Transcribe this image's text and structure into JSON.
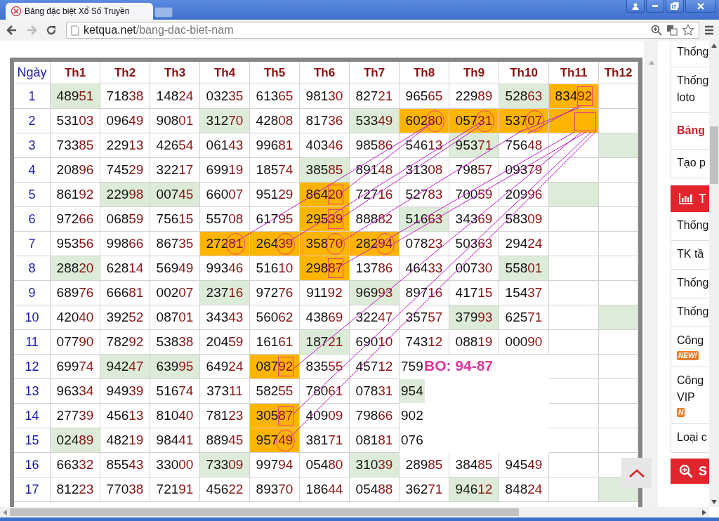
{
  "window": {
    "tab_title": "Bảng đặc biệt Xổ Số Truyền",
    "address": {
      "host": "ketqua.net",
      "path": "/bang-dac-biet-nam"
    }
  },
  "table": {
    "corner": "Ngày",
    "columns": [
      "Th1",
      "Th2",
      "Th3",
      "Th4",
      "Th5",
      "Th6",
      "Th7",
      "Th8",
      "Th9",
      "Th10",
      "Th11",
      "Th12"
    ],
    "rows": [
      {
        "day": "1",
        "cells": [
          {
            "kind": "number",
            "value": "48951",
            "color": "#dcecd8"
          },
          {
            "kind": "number",
            "value": "71838"
          },
          {
            "kind": "number",
            "value": "14824"
          },
          {
            "kind": "number",
            "value": "03235"
          },
          {
            "kind": "number",
            "value": "61365"
          },
          {
            "kind": "number",
            "value": "98130"
          },
          {
            "kind": "number",
            "value": "82721"
          },
          {
            "kind": "number",
            "value": "96565"
          },
          {
            "kind": "number",
            "value": "22989"
          },
          {
            "kind": "number",
            "value": "52863",
            "color": "#dcecd8"
          },
          {
            "kind": "number",
            "value": "83492",
            "color": "#ffb400"
          },
          {
            "kind": "empty"
          }
        ]
      },
      {
        "day": "2",
        "cells": [
          {
            "kind": "number",
            "value": "53103"
          },
          {
            "kind": "number",
            "value": "09649"
          },
          {
            "kind": "number",
            "value": "90801"
          },
          {
            "kind": "number",
            "value": "31270",
            "color": "#dcecd8"
          },
          {
            "kind": "number",
            "value": "42808"
          },
          {
            "kind": "number",
            "value": "81736"
          },
          {
            "kind": "number",
            "value": "53349",
            "color": "#dcecd8"
          },
          {
            "kind": "number",
            "value": "60280",
            "color": "#ffb400"
          },
          {
            "kind": "number",
            "value": "05731",
            "color": "#ffb400"
          },
          {
            "kind": "number",
            "value": "53707",
            "color": "#ffb400"
          },
          {
            "kind": "empty",
            "color": "#ffb400"
          },
          {
            "kind": "empty"
          }
        ]
      },
      {
        "day": "3",
        "cells": [
          {
            "kind": "number",
            "value": "73385"
          },
          {
            "kind": "number",
            "value": "22913"
          },
          {
            "kind": "number",
            "value": "42654"
          },
          {
            "kind": "number",
            "value": "06143"
          },
          {
            "kind": "number",
            "value": "99681"
          },
          {
            "kind": "number",
            "value": "40346"
          },
          {
            "kind": "number",
            "value": "98586"
          },
          {
            "kind": "number",
            "value": "54613"
          },
          {
            "kind": "number",
            "value": "95371",
            "color": "#dcecd8"
          },
          {
            "kind": "number",
            "value": "75648"
          },
          {
            "kind": "empty"
          },
          {
            "kind": "empty",
            "color": "#dcecd8"
          }
        ]
      },
      {
        "day": "4",
        "cells": [
          {
            "kind": "number",
            "value": "20896"
          },
          {
            "kind": "number",
            "value": "74529"
          },
          {
            "kind": "number",
            "value": "32217"
          },
          {
            "kind": "number",
            "value": "69919"
          },
          {
            "kind": "number",
            "value": "18574"
          },
          {
            "kind": "number",
            "value": "38585",
            "color": "#dcecd8"
          },
          {
            "kind": "number",
            "value": "89148"
          },
          {
            "kind": "number",
            "value": "31308"
          },
          {
            "kind": "number",
            "value": "79857"
          },
          {
            "kind": "number",
            "value": "09379"
          },
          {
            "kind": "empty"
          },
          {
            "kind": "empty"
          }
        ]
      },
      {
        "day": "5",
        "cells": [
          {
            "kind": "number",
            "value": "86192"
          },
          {
            "kind": "number",
            "value": "22998",
            "color": "#dcecd8"
          },
          {
            "kind": "number",
            "value": "00745",
            "color": "#dcecd8"
          },
          {
            "kind": "number",
            "value": "66007"
          },
          {
            "kind": "number",
            "value": "95129"
          },
          {
            "kind": "number",
            "value": "86420",
            "color": "#ffb400"
          },
          {
            "kind": "number",
            "value": "72716"
          },
          {
            "kind": "number",
            "value": "52783"
          },
          {
            "kind": "number",
            "value": "70059"
          },
          {
            "kind": "number",
            "value": "20996"
          },
          {
            "kind": "empty",
            "color": "#dcecd8"
          },
          {
            "kind": "empty"
          }
        ]
      },
      {
        "day": "6",
        "cells": [
          {
            "kind": "number",
            "value": "97266"
          },
          {
            "kind": "number",
            "value": "06859"
          },
          {
            "kind": "number",
            "value": "75615"
          },
          {
            "kind": "number",
            "value": "55708"
          },
          {
            "kind": "number",
            "value": "61795"
          },
          {
            "kind": "number",
            "value": "29539",
            "color": "#ffb400"
          },
          {
            "kind": "number",
            "value": "88882"
          },
          {
            "kind": "number",
            "value": "51663",
            "color": "#dcecd8"
          },
          {
            "kind": "number",
            "value": "34369"
          },
          {
            "kind": "number",
            "value": "58309"
          },
          {
            "kind": "empty"
          },
          {
            "kind": "empty"
          }
        ]
      },
      {
        "day": "7",
        "cells": [
          {
            "kind": "number",
            "value": "95356"
          },
          {
            "kind": "number",
            "value": "99866"
          },
          {
            "kind": "number",
            "value": "86735"
          },
          {
            "kind": "number",
            "value": "27281",
            "color": "#ffb400"
          },
          {
            "kind": "number",
            "value": "26439",
            "color": "#ffb400"
          },
          {
            "kind": "number",
            "value": "35870",
            "color": "#ffb400"
          },
          {
            "kind": "number",
            "value": "28294",
            "color": "#ffb400"
          },
          {
            "kind": "number",
            "value": "07823"
          },
          {
            "kind": "number",
            "value": "50363"
          },
          {
            "kind": "number",
            "value": "29424"
          },
          {
            "kind": "empty"
          },
          {
            "kind": "empty"
          }
        ]
      },
      {
        "day": "8",
        "cells": [
          {
            "kind": "number",
            "value": "28820",
            "color": "#dcecd8"
          },
          {
            "kind": "number",
            "value": "62814"
          },
          {
            "kind": "number",
            "value": "56949"
          },
          {
            "kind": "number",
            "value": "99346"
          },
          {
            "kind": "number",
            "value": "51610"
          },
          {
            "kind": "number",
            "value": "29887",
            "color": "#ffb400"
          },
          {
            "kind": "number",
            "value": "13786"
          },
          {
            "kind": "number",
            "value": "46433"
          },
          {
            "kind": "number",
            "value": "00730"
          },
          {
            "kind": "number",
            "value": "55801",
            "color": "#dcecd8"
          },
          {
            "kind": "empty"
          },
          {
            "kind": "empty"
          }
        ]
      },
      {
        "day": "9",
        "cells": [
          {
            "kind": "number",
            "value": "68976"
          },
          {
            "kind": "number",
            "value": "66681"
          },
          {
            "kind": "number",
            "value": "00207"
          },
          {
            "kind": "number",
            "value": "23716",
            "color": "#dcecd8"
          },
          {
            "kind": "number",
            "value": "97276"
          },
          {
            "kind": "number",
            "value": "91192"
          },
          {
            "kind": "number",
            "value": "96993",
            "color": "#dcecd8"
          },
          {
            "kind": "number",
            "value": "89716"
          },
          {
            "kind": "number",
            "value": "41715"
          },
          {
            "kind": "number",
            "value": "15437"
          },
          {
            "kind": "empty"
          },
          {
            "kind": "empty"
          }
        ]
      },
      {
        "day": "10",
        "cells": [
          {
            "kind": "number",
            "value": "42040"
          },
          {
            "kind": "number",
            "value": "39252"
          },
          {
            "kind": "number",
            "value": "08701"
          },
          {
            "kind": "number",
            "value": "34343"
          },
          {
            "kind": "number",
            "value": "56062"
          },
          {
            "kind": "number",
            "value": "43869"
          },
          {
            "kind": "number",
            "value": "32247"
          },
          {
            "kind": "number",
            "value": "35757"
          },
          {
            "kind": "number",
            "value": "37993",
            "color": "#dcecd8"
          },
          {
            "kind": "number",
            "value": "62571"
          },
          {
            "kind": "empty"
          },
          {
            "kind": "empty",
            "color": "#dcecd8"
          }
        ]
      },
      {
        "day": "11",
        "cells": [
          {
            "kind": "number",
            "value": "07790"
          },
          {
            "kind": "number",
            "value": "78292"
          },
          {
            "kind": "number",
            "value": "53838"
          },
          {
            "kind": "number",
            "value": "20459"
          },
          {
            "kind": "number",
            "value": "16161"
          },
          {
            "kind": "number",
            "value": "18721",
            "color": "#dcecd8"
          },
          {
            "kind": "number",
            "value": "69010"
          },
          {
            "kind": "number",
            "value": "74312"
          },
          {
            "kind": "number",
            "value": "08819"
          },
          {
            "kind": "number",
            "value": "00090"
          },
          {
            "kind": "empty"
          },
          {
            "kind": "empty"
          }
        ]
      },
      {
        "day": "12",
        "cells": [
          {
            "kind": "number",
            "value": "69974"
          },
          {
            "kind": "number",
            "value": "94247",
            "color": "#dcecd8"
          },
          {
            "kind": "number",
            "value": "63995",
            "color": "#dcecd8"
          },
          {
            "kind": "number",
            "value": "64924"
          },
          {
            "kind": "number",
            "value": "08792",
            "color": "#ffb400"
          },
          {
            "kind": "number",
            "value": "83555"
          },
          {
            "kind": "number",
            "value": "45712"
          },
          {
            "kind": "cut",
            "value": "759"
          },
          {
            "kind": "covered"
          },
          {
            "kind": "covered"
          },
          {
            "kind": "empty"
          },
          {
            "kind": "empty"
          }
        ]
      },
      {
        "day": "13",
        "cells": [
          {
            "kind": "number",
            "value": "96334"
          },
          {
            "kind": "number",
            "value": "94939"
          },
          {
            "kind": "number",
            "value": "51674"
          },
          {
            "kind": "number",
            "value": "37311"
          },
          {
            "kind": "number",
            "value": "58255"
          },
          {
            "kind": "number",
            "value": "78061"
          },
          {
            "kind": "number",
            "value": "07831"
          },
          {
            "kind": "cut",
            "value": "954",
            "color": "#dcecd8"
          },
          {
            "kind": "covered"
          },
          {
            "kind": "covered"
          },
          {
            "kind": "empty"
          },
          {
            "kind": "empty"
          }
        ]
      },
      {
        "day": "14",
        "cells": [
          {
            "kind": "number",
            "value": "27739"
          },
          {
            "kind": "number",
            "value": "45613"
          },
          {
            "kind": "number",
            "value": "81040"
          },
          {
            "kind": "number",
            "value": "78123"
          },
          {
            "kind": "number",
            "value": "30587",
            "color": "#ffb400"
          },
          {
            "kind": "number",
            "value": "40909"
          },
          {
            "kind": "number",
            "value": "79866"
          },
          {
            "kind": "cut",
            "value": "902"
          },
          {
            "kind": "covered"
          },
          {
            "kind": "covered"
          },
          {
            "kind": "empty"
          },
          {
            "kind": "empty"
          }
        ]
      },
      {
        "day": "15",
        "cells": [
          {
            "kind": "number",
            "value": "02489",
            "color": "#dcecd8"
          },
          {
            "kind": "number",
            "value": "48219"
          },
          {
            "kind": "number",
            "value": "98441"
          },
          {
            "kind": "number",
            "value": "88945"
          },
          {
            "kind": "number",
            "value": "95749",
            "color": "#ffb400"
          },
          {
            "kind": "number",
            "value": "38171"
          },
          {
            "kind": "number",
            "value": "08181"
          },
          {
            "kind": "cut",
            "value": "076"
          },
          {
            "kind": "covered"
          },
          {
            "kind": "covered"
          },
          {
            "kind": "empty"
          },
          {
            "kind": "empty"
          }
        ]
      },
      {
        "day": "16",
        "cells": [
          {
            "kind": "number",
            "value": "66332"
          },
          {
            "kind": "number",
            "value": "85543"
          },
          {
            "kind": "number",
            "value": "33000"
          },
          {
            "kind": "number",
            "value": "73309",
            "color": "#dcecd8"
          },
          {
            "kind": "number",
            "value": "99794"
          },
          {
            "kind": "number",
            "value": "05480"
          },
          {
            "kind": "number",
            "value": "31039",
            "color": "#dcecd8"
          },
          {
            "kind": "number",
            "value": "28985"
          },
          {
            "kind": "number",
            "value": "38485"
          },
          {
            "kind": "number",
            "value": "94549"
          },
          {
            "kind": "empty"
          },
          {
            "kind": "empty"
          }
        ]
      },
      {
        "day": "17",
        "cells": [
          {
            "kind": "number",
            "value": "81223"
          },
          {
            "kind": "number",
            "value": "77038"
          },
          {
            "kind": "number",
            "value": "72191"
          },
          {
            "kind": "number",
            "value": "45622"
          },
          {
            "kind": "number",
            "value": "89370"
          },
          {
            "kind": "number",
            "value": "18644"
          },
          {
            "kind": "number",
            "value": "05488"
          },
          {
            "kind": "number",
            "value": "36271"
          },
          {
            "kind": "number",
            "value": "94612",
            "color": "#dcecd8"
          },
          {
            "kind": "number",
            "value": "84824"
          },
          {
            "kind": "empty"
          },
          {
            "kind": "empty",
            "color": "#dcecd8"
          }
        ]
      }
    ],
    "annotation": "BO: 94-87"
  },
  "sidebar": {
    "items": [
      {
        "kind": "link",
        "label": "Thống"
      },
      {
        "kind": "link",
        "label": "Thống loto"
      },
      {
        "kind": "current",
        "label": "Bảng"
      },
      {
        "kind": "link",
        "label": "Tạo p"
      },
      {
        "kind": "section",
        "label": "T"
      },
      {
        "kind": "link",
        "label": "Thống"
      },
      {
        "kind": "link",
        "label": "TK tầ"
      },
      {
        "kind": "link",
        "label": "Thống"
      },
      {
        "kind": "link",
        "label": "Thống"
      },
      {
        "kind": "link",
        "label": "Công",
        "badge": "NEW!"
      },
      {
        "kind": "link",
        "label": "Công VIP",
        "badge": "N"
      },
      {
        "kind": "link",
        "label": "Loại c"
      },
      {
        "kind": "search",
        "label": "S"
      }
    ]
  }
}
